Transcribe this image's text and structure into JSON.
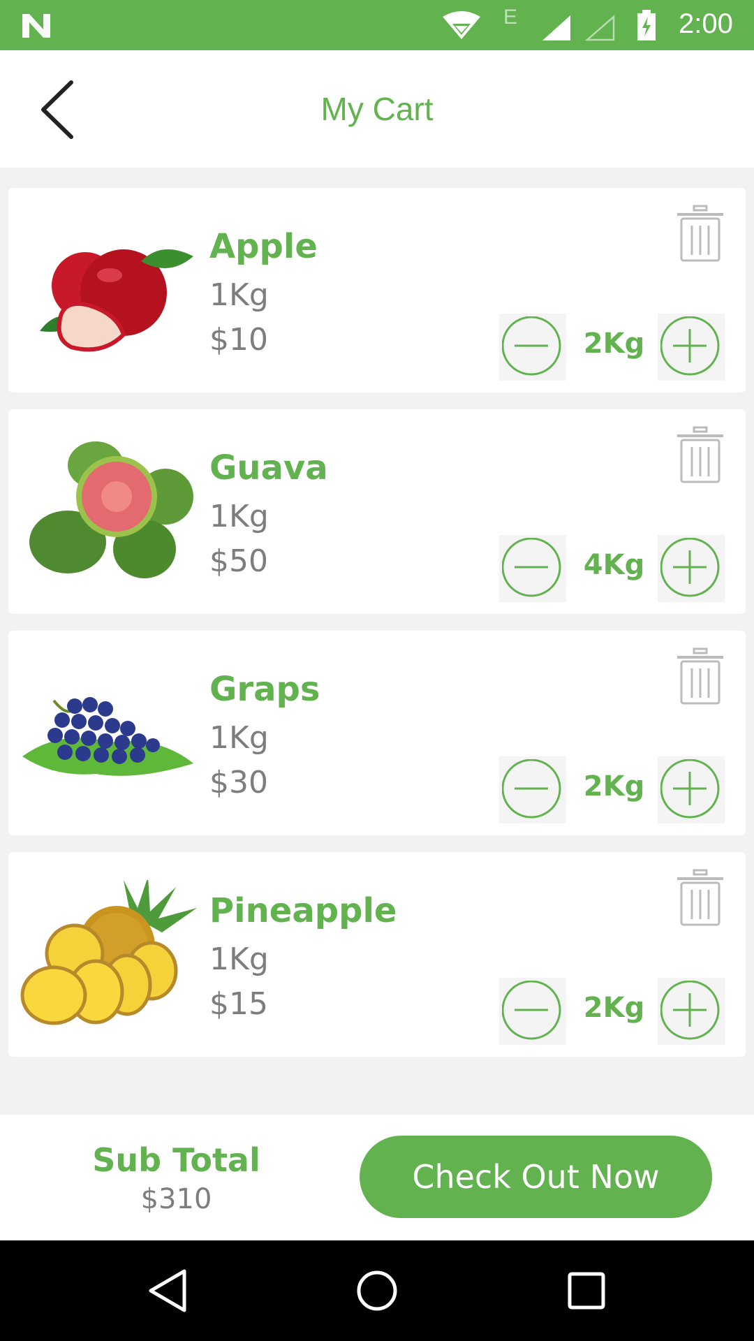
{
  "status_bar": {
    "time": "2:00",
    "network_label": "E"
  },
  "header": {
    "title": "My Cart"
  },
  "items": [
    {
      "name": "Apple",
      "unit": "1Kg",
      "price": "$10",
      "quantity": "2Kg"
    },
    {
      "name": "Guava",
      "unit": "1Kg",
      "price": "$50",
      "quantity": "4Kg"
    },
    {
      "name": "Graps",
      "unit": "1Kg",
      "price": "$30",
      "quantity": "2Kg"
    },
    {
      "name": "Pineapple",
      "unit": "1Kg",
      "price": "$15",
      "quantity": "2Kg"
    }
  ],
  "footer": {
    "subtotal_label": "Sub Total",
    "subtotal_value": "$310",
    "checkout_label": "Check Out Now"
  },
  "colors": {
    "accent": "#62b24f",
    "muted_text": "#7d7d7d"
  },
  "icons": [
    "n-logo-icon",
    "wifi-icon",
    "signal-icon",
    "battery-icon",
    "back-arrow-icon",
    "trash-icon",
    "minus-icon",
    "plus-icon",
    "nav-back-icon",
    "nav-home-icon",
    "nav-recents-icon"
  ]
}
